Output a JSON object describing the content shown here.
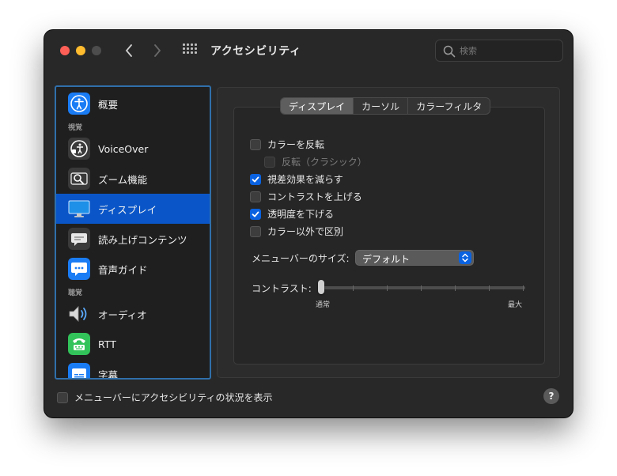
{
  "window": {
    "title": "アクセシビリティ"
  },
  "search": {
    "placeholder": "検索"
  },
  "sidebar": {
    "sections": {
      "vision": "視覚",
      "hearing": "聴覚"
    },
    "items": [
      {
        "label": "概要",
        "icon": "accessibility-icon",
        "selected": false
      },
      {
        "label": "VoiceOver",
        "icon": "voiceover-icon",
        "selected": false
      },
      {
        "label": "ズーム機能",
        "icon": "zoom-icon",
        "selected": false
      },
      {
        "label": "ディスプレイ",
        "icon": "display-icon",
        "selected": true
      },
      {
        "label": "読み上げコンテンツ",
        "icon": "speech-bubble-icon",
        "selected": false
      },
      {
        "label": "音声ガイド",
        "icon": "descriptions-icon",
        "selected": false
      },
      {
        "label": "オーディオ",
        "icon": "speaker-icon",
        "selected": false
      },
      {
        "label": "RTT",
        "icon": "rtt-phone-icon",
        "selected": false
      },
      {
        "label": "字幕",
        "icon": "captions-icon",
        "selected": false
      }
    ]
  },
  "tabs": [
    {
      "label": "ディスプレイ",
      "active": true
    },
    {
      "label": "カーソル",
      "active": false
    },
    {
      "label": "カラーフィルタ",
      "active": false
    }
  ],
  "options": [
    {
      "label": "カラーを反転",
      "checked": false,
      "disabled": false
    },
    {
      "label": "反転（クラシック）",
      "checked": false,
      "disabled": true
    },
    {
      "label": "視差効果を減らす",
      "checked": true,
      "disabled": false
    },
    {
      "label": "コントラストを上げる",
      "checked": false,
      "disabled": false
    },
    {
      "label": "透明度を下げる",
      "checked": true,
      "disabled": false
    },
    {
      "label": "カラー以外で区別",
      "checked": false,
      "disabled": false
    }
  ],
  "menu_bar_size": {
    "label": "メニューバーのサイズ:",
    "value": "デフォルト"
  },
  "contrast": {
    "label": "コントラスト:",
    "min_label": "通常",
    "max_label": "最大",
    "value": 0
  },
  "footer": {
    "show_status_label": "メニューバーにアクセシビリティの状況を表示",
    "checked": false,
    "help_label": "?"
  },
  "colors": {
    "accent": "#0a56c8",
    "checkbox_checked": "#0a62e0",
    "window_bg": "#282828"
  }
}
